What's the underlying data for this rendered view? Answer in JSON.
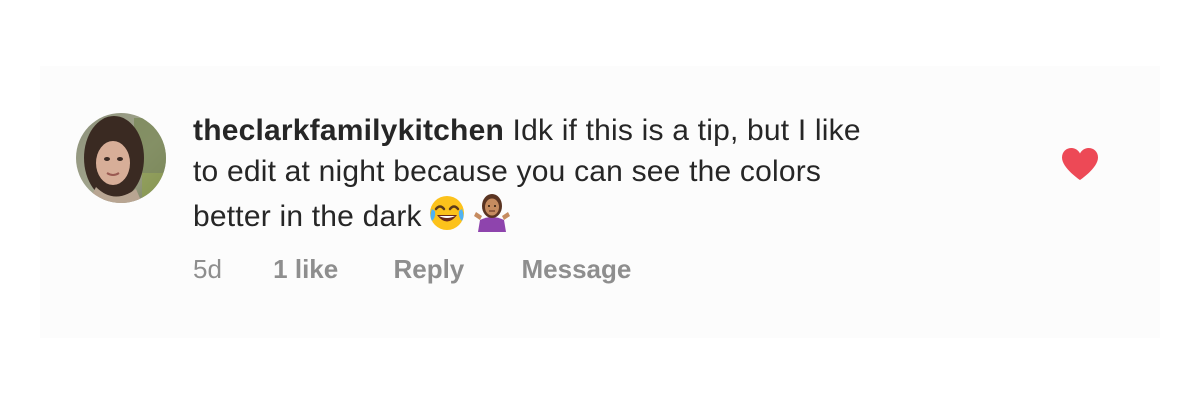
{
  "comment": {
    "username": "theclarkfamilykitchen",
    "text_line_1": " Idk if this is a tip, but I like",
    "text_line_2": "to edit at night because you can see the colors",
    "text_line_3": "better in the dark",
    "emojis": [
      "face-with-tears-of-joy",
      "person-shrugging"
    ],
    "liked": true
  },
  "meta": {
    "time": "5d",
    "likes": "1 like",
    "reply": "Reply",
    "message": "Message"
  },
  "colors": {
    "text": "#262626",
    "secondary": "#8e8e8e",
    "heart": "#ed4956",
    "card_background": "#fcfcfc"
  },
  "icons": {
    "avatar": "profile-photo",
    "like": "heart-icon"
  }
}
